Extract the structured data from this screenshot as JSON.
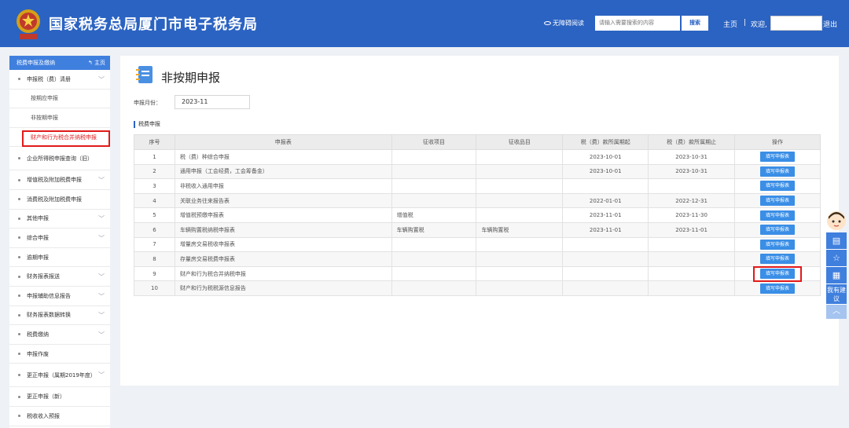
{
  "header": {
    "title": "国家税务总局厦门市电子税务局",
    "accessibility": "无障碍阅读",
    "search_placeholder": "请输入需要搜索的内容",
    "search_button": "搜索",
    "home": "主页",
    "separator": "|",
    "welcome": "欢迎,",
    "logout": "退出",
    "colors": {
      "header_bg": "#2b63c2",
      "accent": "#3a8ee6",
      "highlight": "#e01a1a"
    }
  },
  "sidebar": {
    "title": "税费申报及缴纳",
    "home": "主页",
    "items": [
      {
        "label": "申报税（费）清册",
        "type": "group",
        "expanded": true
      },
      {
        "label": "按期应申报",
        "type": "sub"
      },
      {
        "label": "非按期申报",
        "type": "sub"
      },
      {
        "label": "财产和行为税合并纳税申报",
        "type": "sub",
        "active": true
      },
      {
        "label": "企业所得税申报查询（旧）",
        "type": "item"
      },
      {
        "label": "增值税及附加税费申报",
        "type": "group"
      },
      {
        "label": "消费税及附加税费申报",
        "type": "item"
      },
      {
        "label": "其他申报",
        "type": "group"
      },
      {
        "label": "综合申报",
        "type": "group"
      },
      {
        "label": "逾期申报",
        "type": "item"
      },
      {
        "label": "财务报表报送",
        "type": "group"
      },
      {
        "label": "申报辅助信息报告",
        "type": "group"
      },
      {
        "label": "财务报表数据转换",
        "type": "group"
      },
      {
        "label": "税费缴纳",
        "type": "group"
      },
      {
        "label": "申报作废",
        "type": "item"
      },
      {
        "label": "更正申报（属期2019年度）",
        "type": "group"
      },
      {
        "label": "更正申报（新）",
        "type": "item"
      },
      {
        "label": "税收收入预报",
        "type": "item"
      }
    ]
  },
  "main": {
    "page_title": "非按期申报",
    "month_label": "申报月份：",
    "month_value": "2023-11",
    "section_title": "税费申报",
    "table": {
      "headers": [
        "序号",
        "申报表",
        "征收项目",
        "征收品目",
        "税（费）款所属期起",
        "税（费）款所属期止",
        "操作"
      ],
      "action_label": "填写申报表",
      "rows": [
        {
          "no": "1",
          "form": "税（费）种综合申报",
          "item": "",
          "sub_item": "",
          "start": "2023-10-01",
          "end": "2023-10-31"
        },
        {
          "no": "2",
          "form": "通用申报（工会经费，工会筹备金）",
          "item": "",
          "sub_item": "",
          "start": "2023-10-01",
          "end": "2023-10-31"
        },
        {
          "no": "3",
          "form": "非税收入通用申报",
          "item": "",
          "sub_item": "",
          "start": "",
          "end": ""
        },
        {
          "no": "4",
          "form": "关联业务往来报告表",
          "item": "",
          "sub_item": "",
          "start": "2022-01-01",
          "end": "2022-12-31"
        },
        {
          "no": "5",
          "form": "增值税预缴申报表",
          "item": "增值税",
          "sub_item": "",
          "start": "2023-11-01",
          "end": "2023-11-30"
        },
        {
          "no": "6",
          "form": "车辆购置税纳税申报表",
          "item": "车辆购置税",
          "sub_item": "车辆购置税",
          "start": "2023-11-01",
          "end": "2023-11-01"
        },
        {
          "no": "7",
          "form": "增量房交易税收申报表",
          "item": "",
          "sub_item": "",
          "start": "",
          "end": ""
        },
        {
          "no": "8",
          "form": "存量房交易税费申报表",
          "item": "",
          "sub_item": "",
          "start": "",
          "end": ""
        },
        {
          "no": "9",
          "form": "财产和行为税合并纳税申报",
          "item": "",
          "sub_item": "",
          "start": "",
          "end": "",
          "highlighted": true
        },
        {
          "no": "10",
          "form": "财产和行为税税源信息报告",
          "item": "",
          "sub_item": "",
          "start": "",
          "end": ""
        }
      ]
    }
  },
  "float_bar": {
    "suggest": "我有建议",
    "icons": [
      "assistant-avatar",
      "form-icon",
      "star-icon",
      "calculator-icon",
      "up-arrow-icon"
    ]
  }
}
